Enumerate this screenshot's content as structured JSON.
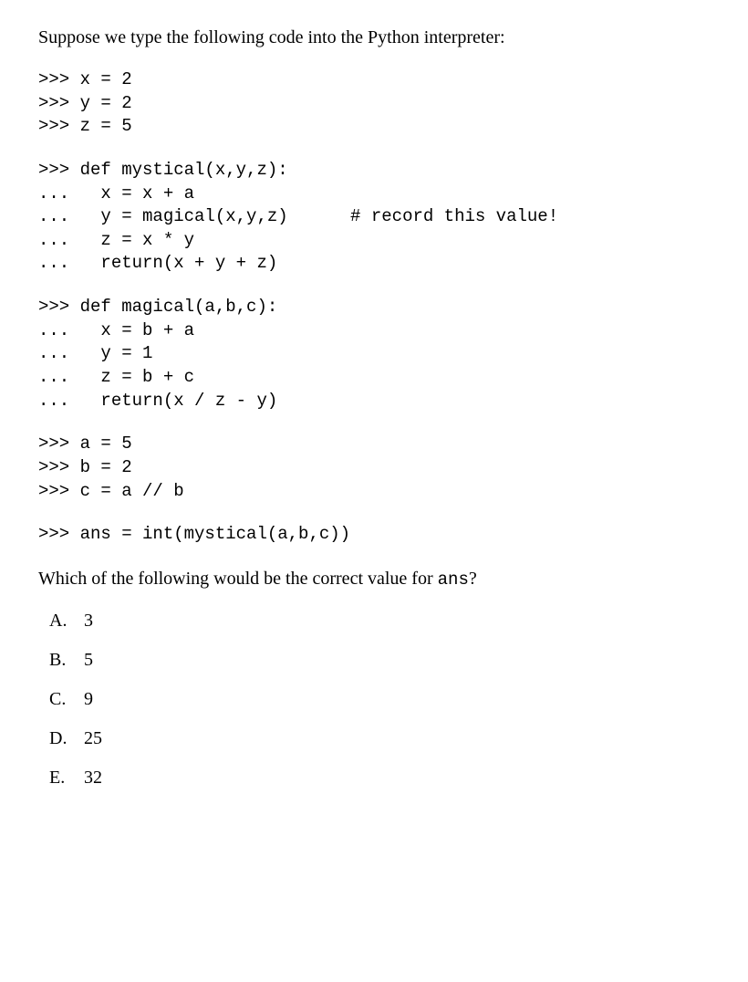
{
  "intro": "Suppose we type the following code into the Python interpreter:",
  "code_block_1": ">>> x = 2\n>>> y = 2\n>>> z = 5",
  "code_block_2": ">>> def mystical(x,y,z):\n...   x = x + a\n...   y = magical(x,y,z)      # record this value!\n...   z = x * y\n...   return(x + y + z)",
  "code_block_3": ">>> def magical(a,b,c):\n...   x = b + a\n...   y = 1\n...   z = b + c\n...   return(x / z - y)",
  "code_block_4": ">>> a = 5\n>>> b = 2\n>>> c = a // b",
  "code_block_5": ">>> ans = int(mystical(a,b,c))",
  "question_prefix": "Which of the following would be the correct value for ",
  "question_code": "ans",
  "question_suffix": "?",
  "answers": [
    {
      "letter": "A.",
      "value": "3"
    },
    {
      "letter": "B.",
      "value": "5"
    },
    {
      "letter": "C.",
      "value": "9"
    },
    {
      "letter": "D.",
      "value": "25"
    },
    {
      "letter": "E.",
      "value": "32"
    }
  ]
}
